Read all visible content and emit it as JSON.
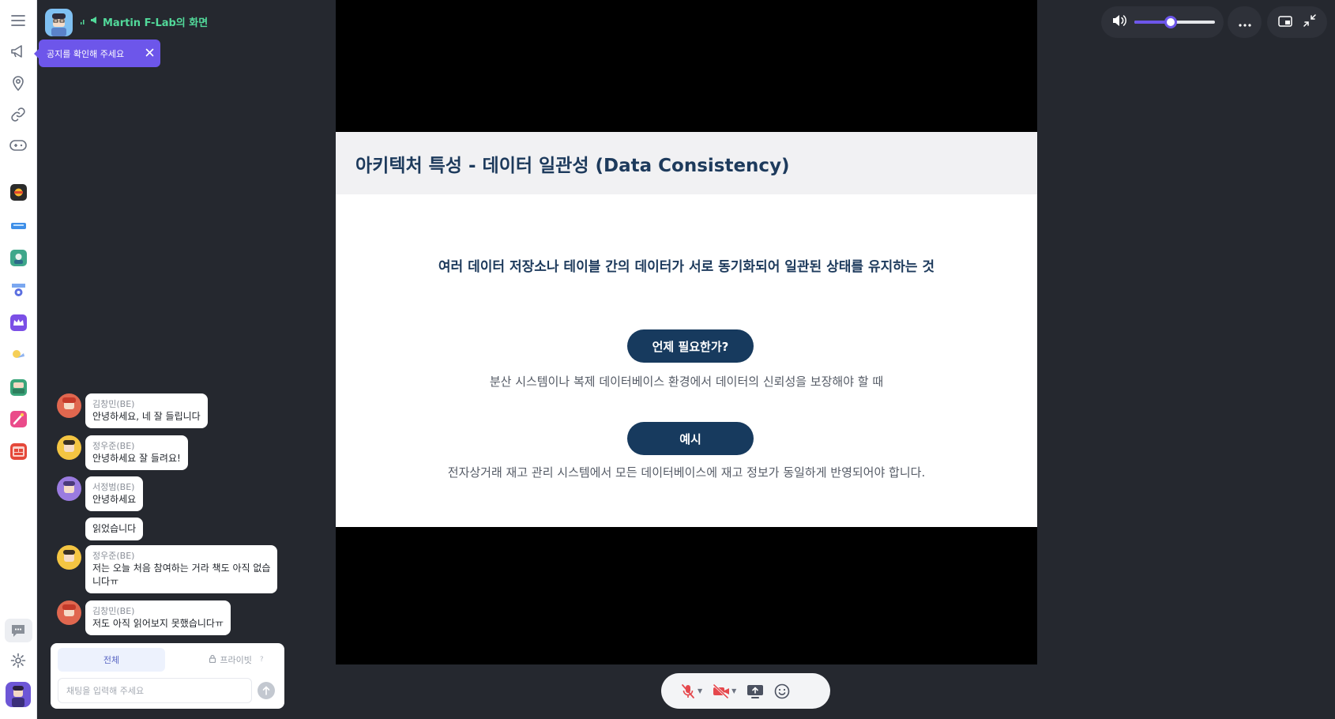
{
  "host": {
    "name": "Martin F-Lab의 화면"
  },
  "notice": {
    "label": "공지를 확인해 주세요"
  },
  "slide": {
    "title": "아키텍처 특성 - 데이터 일관성 (Data Consistency)",
    "definition": "여러 데이터 저장소나 테이블 간의 데이터가 서로 동기화되어 일관된 상태를 유지하는 것",
    "when_label": "언제 필요한가?",
    "when_text": "분산 시스템이나 복제 데이터베이스 환경에서 데이터의 신뢰성을 보장해야 할 때",
    "example_label": "예시",
    "example_text": "전자상거래 재고 관리 시스템에서 모든 데이터베이스에 재고 정보가 동일하게 반영되어야 합니다."
  },
  "volume": {
    "level": 0.45
  },
  "chat": {
    "messages": [
      {
        "name": "김창민(BE)",
        "text": "안녕하세요, 네 잘 들립니다",
        "avatar_color": "#e0674f"
      },
      {
        "name": "정우준(BE)",
        "text": "안녕하세요 잘 들려요!",
        "avatar_color": "#f4c542"
      },
      {
        "name": "서정범(BE)",
        "text": "안녕하세요",
        "avatar_color": "#9a7be0"
      },
      {
        "name": "",
        "text": "읽었습니다",
        "avatar_color": ""
      },
      {
        "name": "정우준(BE)",
        "text": "저는 오늘 처음 참여하는 거라 책도 아직 없습",
        "text2": "니다ㅠ",
        "avatar_color": "#f4c542"
      },
      {
        "name": "김창민(BE)",
        "text": "저도 아직 읽어보지 못했습니다ㅠ",
        "avatar_color": "#e0674f"
      }
    ],
    "tab_all": "전체",
    "tab_private": "프라이빗",
    "input_placeholder": "채팅을 입력해 주세요"
  },
  "colors": {
    "accent": "#6d56ea",
    "slide_navy": "#173a5e",
    "host_green": "#52d99a"
  }
}
